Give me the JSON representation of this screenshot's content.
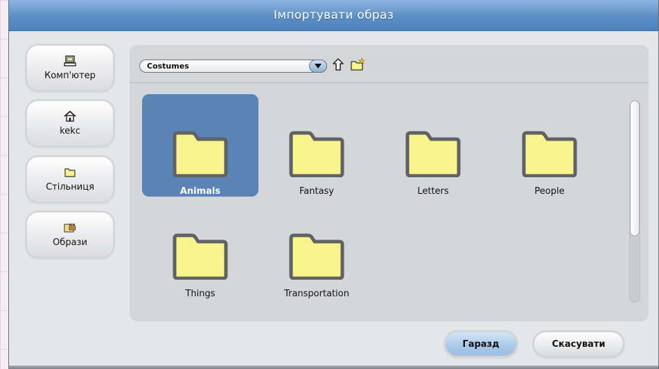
{
  "dialog": {
    "title": "Імпортувати образ"
  },
  "sidebar": {
    "items": [
      {
        "label": "Комп'ютер",
        "icon": "computer-icon"
      },
      {
        "label": "kekc",
        "icon": "home-icon"
      },
      {
        "label": "Стільниця",
        "icon": "desktop-folder-icon"
      },
      {
        "label": "Образи",
        "icon": "costumes-cat-icon"
      }
    ]
  },
  "browser": {
    "location": "Costumes",
    "icons": [
      "up-folder-icon",
      "new-folder-icon"
    ],
    "files": [
      {
        "name": "Animals",
        "selected": true
      },
      {
        "name": "Fantasy",
        "selected": false
      },
      {
        "name": "Letters",
        "selected": false
      },
      {
        "name": "People",
        "selected": false
      },
      {
        "name": "Things",
        "selected": false
      },
      {
        "name": "Transportation",
        "selected": false
      }
    ]
  },
  "buttons": {
    "ok": "Гаразд",
    "cancel": "Скасувати"
  },
  "colors": {
    "title_bar": "#5b8ec6",
    "selection": "#5b84b6",
    "folder_fill": "#f7f48c",
    "folder_stroke": "#5f6166"
  }
}
